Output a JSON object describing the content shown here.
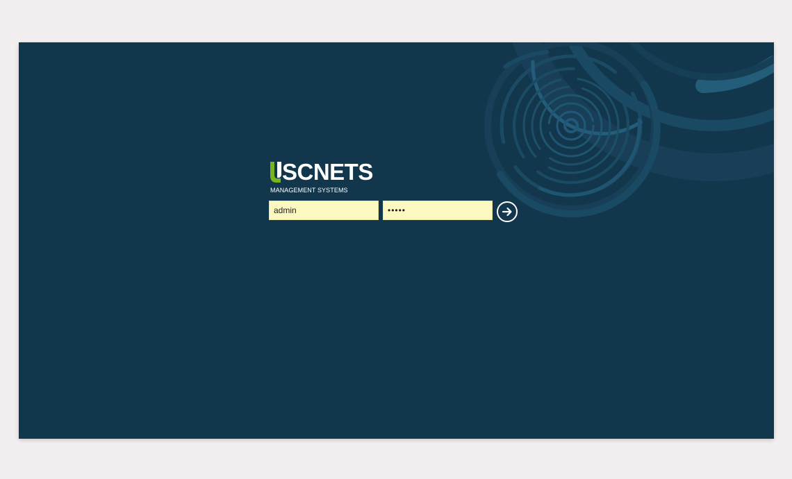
{
  "brand": {
    "logo_first_letter": "U",
    "logo_rest": "SCNETS",
    "subtitle": "MANAGEMENT SYSTEMS",
    "accent_color": "#7ab41d"
  },
  "login": {
    "username_value": "admin",
    "password_value": "abcde",
    "submit_icon": "arrow-right-icon"
  },
  "colors": {
    "page_background": "#f3eff1",
    "screen_background": "#12374c",
    "field_background": "#fbf9bf",
    "decor_ring": "#1e5671"
  }
}
